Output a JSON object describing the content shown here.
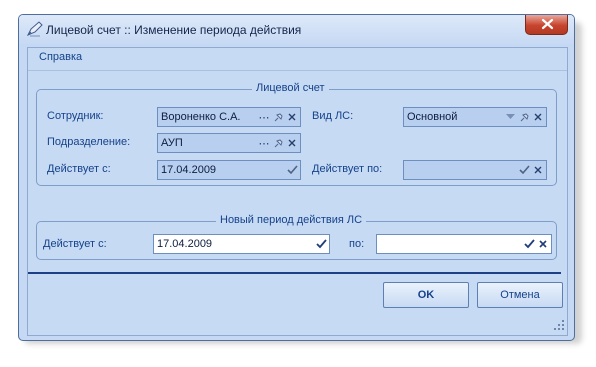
{
  "window": {
    "title": "Лицевой счет :: Изменение периода действия",
    "close_icon": "close-icon",
    "app_icon": "pen-icon"
  },
  "menu": {
    "help_label": "Справка"
  },
  "account_group": {
    "legend": "Лицевой счет",
    "employee_label": "Сотрудник:",
    "employee_value": "Вороненко С.А.",
    "department_label": "Подразделение:",
    "department_value": "АУП",
    "valid_from_label": "Действует с:",
    "valid_from_value": "17.04.2009",
    "type_label": "Вид ЛС:",
    "type_value": "Основной",
    "valid_to_label": "Действует по:",
    "valid_to_value": ""
  },
  "new_period_group": {
    "legend": "Новый период действия ЛС",
    "from_label": "Действует с:",
    "from_value": "17.04.2009",
    "to_label": "по:",
    "to_value": ""
  },
  "buttons": {
    "ok_label": "OK",
    "cancel_label": "Отмена"
  },
  "icons": {
    "ellipsis": "ellipsis-icon",
    "pin": "pin-icon",
    "clear": "clear-x-icon",
    "check": "check-icon",
    "dropdown": "dropdown-arrow-icon"
  },
  "colors": {
    "window_bg": "#c6daf4",
    "label_text": "#15428b",
    "disabled_field": "#b8cff0",
    "divider": "#1c3f86",
    "close_button": "#c7442d"
  }
}
